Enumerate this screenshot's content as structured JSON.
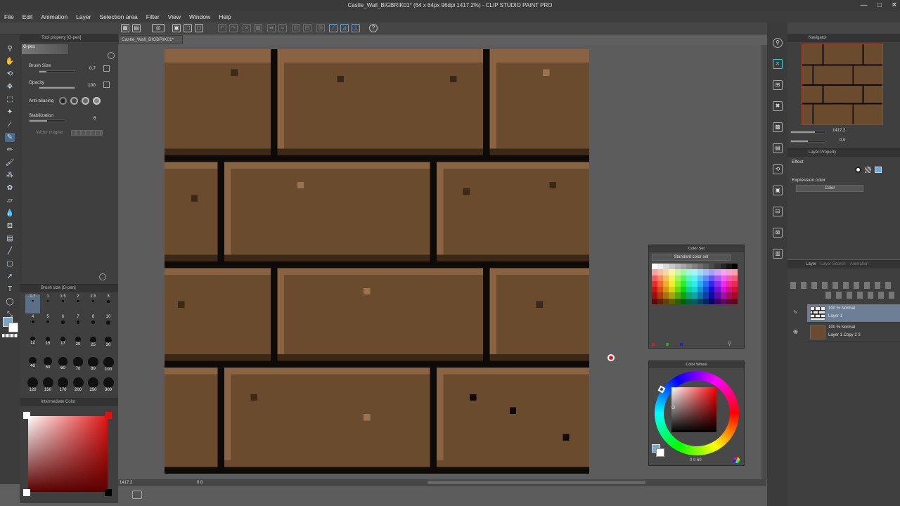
{
  "window": {
    "title": "Castle_Wall_BIGBRIK01* (64 x 64px 96dpi 1417.2%)  - CLIP STUDIO PAINT PRO",
    "controls": [
      "—",
      "□",
      "✕"
    ]
  },
  "menu": [
    "File",
    "Edit",
    "Animation",
    "Layer",
    "Selection area",
    "Filter",
    "View",
    "Window",
    "Help"
  ],
  "document_tab": "Castle_Wall_BIGBRIK01*",
  "tool_property": {
    "header": "Tool property [G-pen]",
    "tool_name": "G-pen",
    "brush_size_label": "Brush Size",
    "brush_size_value": "0.7",
    "brush_size_level": 0.2,
    "opacity_label": "Opacity",
    "opacity_value": "100",
    "opacity_level": 1.0,
    "antialias_label": "Anti-aliasing",
    "stabilization_label": "Stabilization",
    "stabilization_value": "6",
    "stabilization_level": 0.5,
    "vector_magnet_label": "Vector magnet"
  },
  "brush_size_palette": {
    "header": "Brush size [G-pen]",
    "sizes": [
      "0.7",
      "1",
      "1.5",
      "2",
      "2.5",
      "3",
      "4",
      "5",
      "6",
      "7",
      "8",
      "10",
      "12",
      "15",
      "17",
      "20",
      "25",
      "30",
      "40",
      "50",
      "60",
      "70",
      "80",
      "100",
      "120",
      "150",
      "170",
      "200",
      "250",
      "300"
    ]
  },
  "intermediate_color": {
    "header": "Intermediate Color"
  },
  "status": {
    "zoom": "1417.2",
    "rotation": "0.0"
  },
  "navigator": {
    "header": "Navigator",
    "zoom": "1417.2",
    "rotation": "0.0"
  },
  "layer_property": {
    "header": "Layer Property",
    "effect_label": "Effect",
    "expression_color_label": "Expression color",
    "expression_color_value": "Color"
  },
  "layers": {
    "tabs": [
      "Layer",
      "Layer Search",
      "Animation"
    ],
    "items": [
      {
        "blend": "100 % Normal",
        "name": "Layer 1"
      },
      {
        "blend": "100 % Normal",
        "name": "Layer 1 Copy 2 2"
      }
    ]
  },
  "color_set": {
    "header": "Color Set",
    "set_name": "Standard color set"
  },
  "color_wheel": {
    "header": "Color Wheel",
    "readout": "0 0 60"
  },
  "colors": {
    "accent": "#e02020",
    "brick": "#6a4b2e",
    "mortar": "#0d0a08"
  }
}
